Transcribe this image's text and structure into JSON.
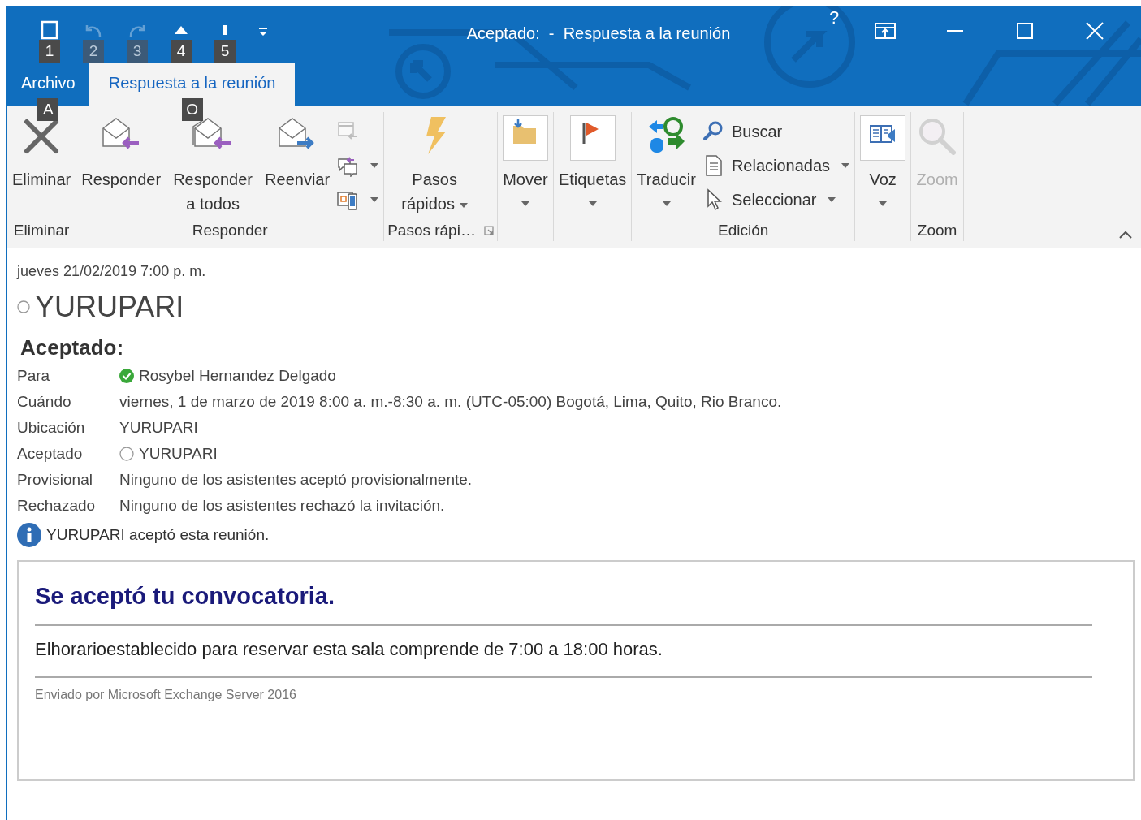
{
  "window": {
    "title": "Aceptado:  -  Respuesta a la reunión",
    "help": "?"
  },
  "quick_access": [
    {
      "key_tip": "1",
      "disabled": false
    },
    {
      "key_tip": "2",
      "disabled": true
    },
    {
      "key_tip": "3",
      "disabled": true
    },
    {
      "key_tip": "4",
      "disabled": false
    },
    {
      "key_tip": "5",
      "disabled": false
    }
  ],
  "tabs": [
    {
      "label": "Archivo",
      "selected": false,
      "key_tip": "A"
    },
    {
      "label": "Respuesta a la reunión",
      "selected": true,
      "key_tip": "O"
    }
  ],
  "ribbon": {
    "groups": [
      {
        "label": "Eliminar",
        "items": [
          {
            "kind": "large",
            "label": "Eliminar",
            "dropdown": false,
            "disabled": false
          }
        ]
      },
      {
        "label": "Responder",
        "items": [
          {
            "kind": "large",
            "label": "Responder",
            "dropdown": false,
            "disabled": false
          },
          {
            "kind": "large",
            "label": "Responder a todos",
            "dropdown": false,
            "disabled": false
          },
          {
            "kind": "large",
            "label": "Reenviar",
            "dropdown": false,
            "disabled": false
          },
          {
            "kind": "icon",
            "dropdown": false,
            "disabled": true
          },
          {
            "kind": "icon",
            "dropdown": true,
            "disabled": false
          },
          {
            "kind": "icon",
            "dropdown": true,
            "disabled": false
          }
        ]
      },
      {
        "label": "Pasos rápi…",
        "launcher": true,
        "items": [
          {
            "kind": "large",
            "label": "Pasos rápidos",
            "dropdown": true,
            "disabled": false
          }
        ]
      },
      {
        "items": [
          {
            "kind": "boxed",
            "label": "Mover",
            "dropdown": true,
            "disabled": false
          }
        ]
      },
      {
        "items": [
          {
            "kind": "boxed",
            "label": "Etiquetas",
            "dropdown": true,
            "disabled": false
          }
        ]
      },
      {
        "label": "Edición",
        "items": [
          {
            "kind": "menu",
            "label": "Traducir",
            "dropdown": true,
            "disabled": false
          },
          {
            "kind": "small",
            "label": "Buscar",
            "dropdown": false,
            "disabled": false
          },
          {
            "kind": "small",
            "label": "Relacionadas",
            "dropdown": true,
            "disabled": false
          },
          {
            "kind": "small",
            "label": "Seleccionar",
            "dropdown": true,
            "disabled": false
          }
        ]
      },
      {
        "items": [
          {
            "kind": "boxed",
            "label": "Voz",
            "dropdown": true,
            "disabled": false
          }
        ]
      },
      {
        "label": "Zoom",
        "items": [
          {
            "kind": "large",
            "label": "Zoom",
            "dropdown": false,
            "disabled": true
          }
        ]
      }
    ]
  },
  "message": {
    "date": "jueves 21/02/2019 7:00 p. m.",
    "subject": "YURUPARI",
    "status": "Aceptado:",
    "fields": [
      {
        "label": "Para",
        "kind": "person",
        "value": "Rosybel Hernandez Delgado"
      },
      {
        "label": "Cuándo",
        "kind": "text",
        "value": "viernes, 1 de marzo de 2019 8:00 a. m.-8:30 a. m. (UTC-05:00) Bogotá, Lima, Quito, Rio Branco."
      },
      {
        "label": "Ubicación",
        "kind": "text",
        "value": "YURUPARI"
      },
      {
        "label": "Aceptado",
        "kind": "link",
        "value": "YURUPARI"
      },
      {
        "label": "Provisional",
        "kind": "text",
        "value": "Ninguno de los asistentes aceptó provisionalmente."
      },
      {
        "label": "Rechazado",
        "kind": "text",
        "value": "Ninguno de los asistentes rechazó la invitación."
      }
    ],
    "info": "YURUPARI aceptó esta reunión.",
    "body": {
      "heading": "Se aceptó tu convocatoria.",
      "text": "Elhorarioestablecido para reservar esta sala comprende de 7:00 a 18:00 horas.",
      "footer": "Enviado por Microsoft Exchange Server 2016"
    }
  }
}
